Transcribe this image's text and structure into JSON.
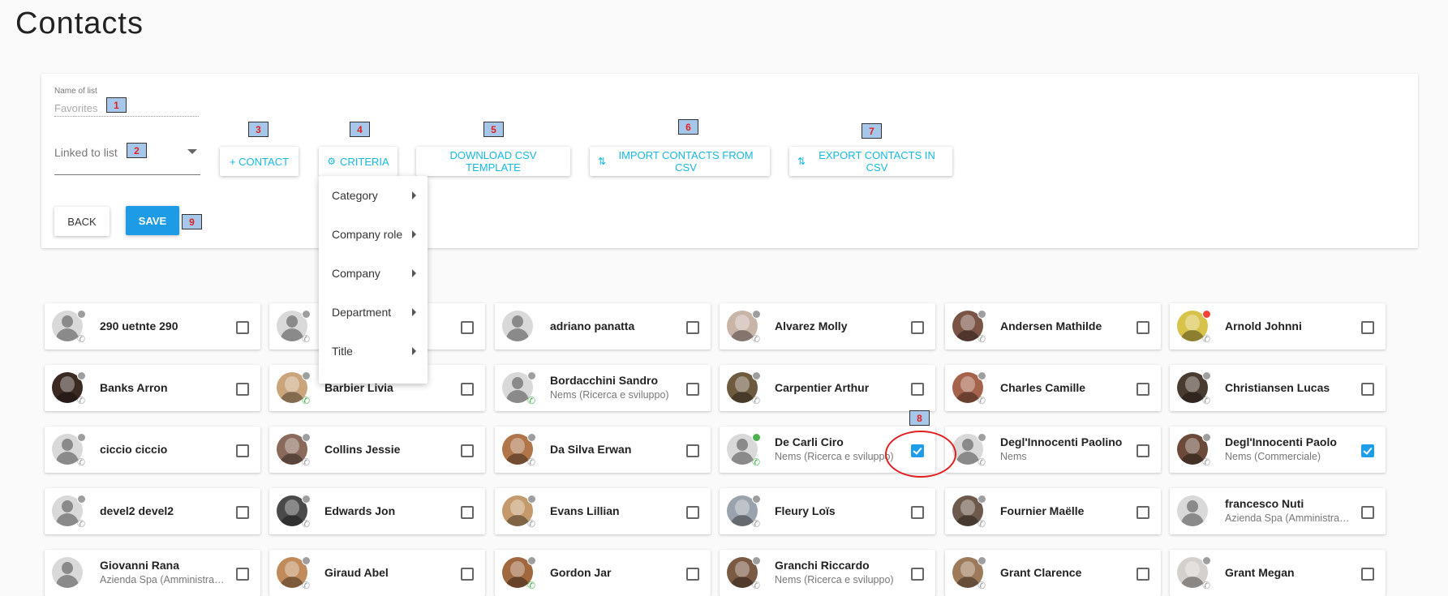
{
  "page": {
    "title": "Contacts"
  },
  "form": {
    "name_label": "Name of list",
    "name_value": "Favorites",
    "linked_label": "Linked to list",
    "buttons": {
      "contact": "+ CONTACT",
      "criteria": "CRITERIA",
      "download": "DOWNLOAD CSV TEMPLATE",
      "import": "IMPORT CONTACTS FROM CSV",
      "export": "EXPORT CONTACTS IN CSV",
      "back": "BACK",
      "save": "SAVE"
    }
  },
  "criteria_menu": [
    "Category",
    "Company role",
    "Company",
    "Department",
    "Title"
  ],
  "badges": [
    "1",
    "2",
    "3",
    "4",
    "5",
    "6",
    "7",
    "8",
    "9"
  ],
  "colors": {
    "accent": "#16b8e0",
    "save": "#1d9ce5",
    "checked": "#1e9ee8",
    "badge_bg": "#a7c7ea",
    "badge_text": "#e32020",
    "online": "#4caf50",
    "busy": "#f44336",
    "away": "#9e9e9e"
  },
  "contacts": [
    {
      "name": "290 uetnte 290",
      "sub": "",
      "photo": false,
      "status": "away",
      "phone": "grey",
      "checked": false
    },
    {
      "name": "",
      "sub": "",
      "photo": false,
      "status": "away",
      "phone": "grey",
      "checked": false
    },
    {
      "name": "adriano panatta",
      "sub": "",
      "photo": false,
      "status": "",
      "phone": "",
      "checked": false
    },
    {
      "name": "Alvarez Molly",
      "sub": "",
      "photo": true,
      "color": "#c9b4a8",
      "status": "away",
      "phone": "grey",
      "checked": false
    },
    {
      "name": "Andersen Mathilde",
      "sub": "",
      "photo": true,
      "color": "#7a5444",
      "status": "away",
      "phone": "grey",
      "checked": false
    },
    {
      "name": "Arnold Johnni",
      "sub": "",
      "photo": true,
      "color": "#d8c34a",
      "status": "busy",
      "phone": "grey",
      "checked": false
    },
    {
      "name": "Banks Arron",
      "sub": "",
      "photo": true,
      "color": "#3b2a22",
      "status": "away",
      "phone": "grey",
      "checked": false
    },
    {
      "name": "Barbier Livia",
      "sub": "",
      "photo": true,
      "color": "#caa57c",
      "status": "away",
      "phone": "green",
      "checked": false
    },
    {
      "name": "Bordacchini Sandro",
      "sub": "Nems (Ricerca e sviluppo)",
      "photo": false,
      "status": "away",
      "phone": "green",
      "checked": false
    },
    {
      "name": "Carpentier Arthur",
      "sub": "",
      "photo": true,
      "color": "#6e5a3e",
      "status": "away",
      "phone": "grey",
      "checked": false
    },
    {
      "name": "Charles Camille",
      "sub": "",
      "photo": true,
      "color": "#a5634c",
      "status": "away",
      "phone": "grey",
      "checked": false
    },
    {
      "name": "Christiansen Lucas",
      "sub": "",
      "photo": true,
      "color": "#4a3b30",
      "status": "away",
      "phone": "grey",
      "checked": false
    },
    {
      "name": "ciccio ciccio",
      "sub": "",
      "photo": false,
      "status": "away",
      "phone": "grey",
      "checked": false
    },
    {
      "name": "Collins Jessie",
      "sub": "",
      "photo": true,
      "color": "#8a6a5a",
      "status": "away",
      "phone": "grey",
      "checked": false
    },
    {
      "name": "Da Silva Erwan",
      "sub": "",
      "photo": true,
      "color": "#b0764a",
      "status": "away",
      "phone": "grey",
      "checked": false
    },
    {
      "name": "De Carli Ciro",
      "sub": "Nems (Ricerca e sviluppo)",
      "photo": false,
      "status": "online",
      "phone": "green",
      "checked": true
    },
    {
      "name": "Degl'Innocenti Paolino",
      "sub": "Nems",
      "photo": false,
      "status": "away",
      "phone": "grey",
      "checked": false
    },
    {
      "name": "Degl'Innocenti Paolo",
      "sub": "Nems (Commerciale)",
      "photo": true,
      "color": "#6b4a3a",
      "status": "away",
      "phone": "grey",
      "checked": true
    },
    {
      "name": "devel2 devel2",
      "sub": "",
      "photo": false,
      "status": "away",
      "phone": "grey",
      "checked": false
    },
    {
      "name": "Edwards Jon",
      "sub": "",
      "photo": true,
      "color": "#4a4a4a",
      "status": "away",
      "phone": "grey",
      "checked": false
    },
    {
      "name": "Evans Lillian",
      "sub": "",
      "photo": true,
      "color": "#c49a6c",
      "status": "away",
      "phone": "grey",
      "checked": false
    },
    {
      "name": "Fleury Loïs",
      "sub": "",
      "photo": true,
      "color": "#9aa3ad",
      "status": "away",
      "phone": "grey",
      "checked": false
    },
    {
      "name": "Fournier Maëlle",
      "sub": "",
      "photo": true,
      "color": "#6d5a4c",
      "status": "away",
      "phone": "grey",
      "checked": false
    },
    {
      "name": "francesco Nuti",
      "sub": "Azienda Spa (Amministrazione)",
      "photo": false,
      "status": "",
      "phone": "",
      "checked": false
    },
    {
      "name": "Giovanni Rana",
      "sub": "Azienda Spa (Amministrazione)",
      "photo": false,
      "status": "",
      "phone": "",
      "checked": false
    },
    {
      "name": "Giraud Abel",
      "sub": "",
      "photo": true,
      "color": "#c08a5a",
      "status": "away",
      "phone": "grey",
      "checked": false
    },
    {
      "name": "Gordon Jar",
      "sub": "",
      "photo": true,
      "color": "#a0683f",
      "status": "away",
      "phone": "green",
      "checked": false
    },
    {
      "name": "Granchi Riccardo",
      "sub": "Nems (Ricerca e sviluppo)",
      "photo": true,
      "color": "#7b5a44",
      "status": "away",
      "phone": "grey",
      "checked": false
    },
    {
      "name": "Grant Clarence",
      "sub": "",
      "photo": true,
      "color": "#9c7a5a",
      "status": "away",
      "phone": "grey",
      "checked": false
    },
    {
      "name": "Grant Megan",
      "sub": "",
      "photo": true,
      "color": "#d4d0cc",
      "status": "away",
      "phone": "grey",
      "checked": false
    }
  ]
}
